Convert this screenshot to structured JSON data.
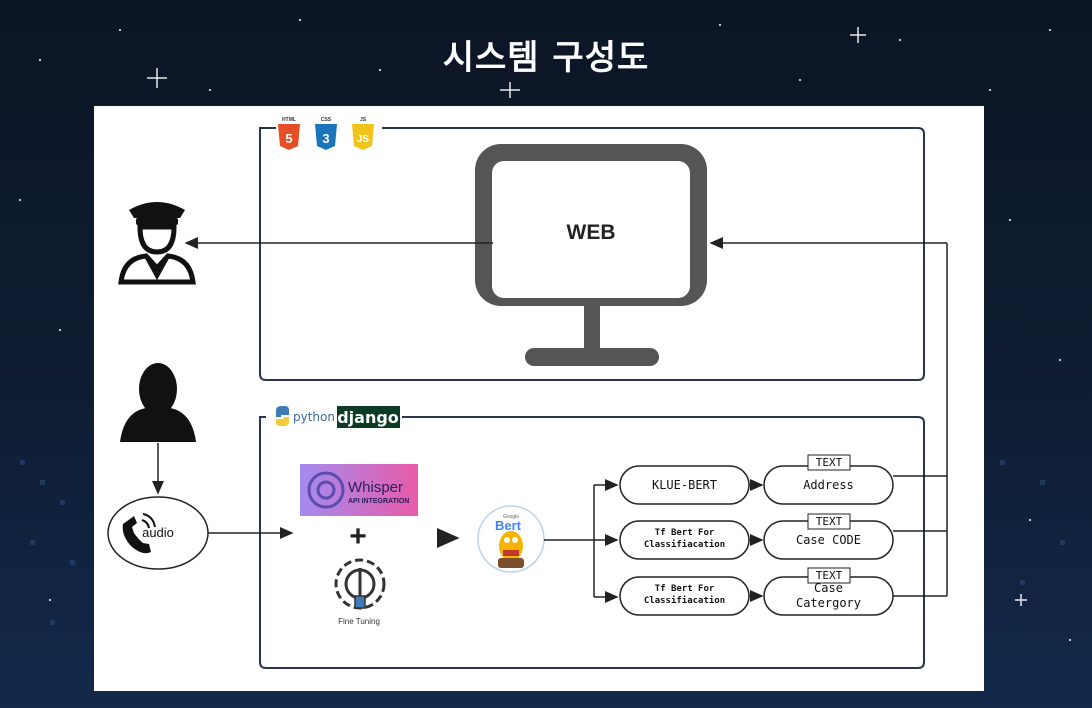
{
  "title": "시스템 구성도",
  "web": {
    "badges": [
      "HTML",
      "CSS",
      "JS"
    ],
    "badge_digits": [
      "5",
      "3",
      "JS"
    ],
    "monitor_label": "WEB"
  },
  "backend": {
    "python_label": "python",
    "django_label": "django"
  },
  "audio": {
    "label": "audio"
  },
  "whisper": {
    "name": "Whisper",
    "subtitle": "API INTEGRATION"
  },
  "plus": "+",
  "fine_tuning": "Fine Tuning",
  "bert_logo": {
    "google": "Google",
    "name": "Bert"
  },
  "models": [
    "KLUE-BERT",
    "Tf Bert For\nClassifiacation",
    "Tf Bert For\nClassifiacation"
  ],
  "outputs": [
    {
      "tag": "TEXT",
      "label": "Address"
    },
    {
      "tag": "TEXT",
      "label": "Case CODE"
    },
    {
      "tag": "TEXT",
      "label": "Case\nCatergory"
    }
  ],
  "colors": {
    "html": "#e44d26",
    "css": "#1b73ba",
    "js": "#f0c419",
    "django": "#0c3c26",
    "whisper_a": "#a48bf0",
    "whisper_b": "#e85ba8"
  }
}
